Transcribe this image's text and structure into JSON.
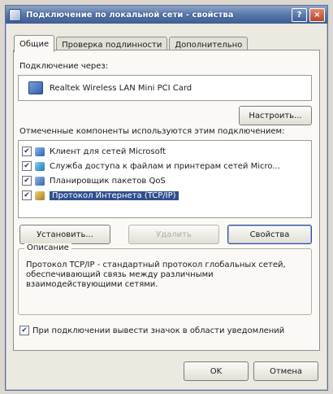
{
  "window": {
    "title": "Подключение по локальной сети - свойства",
    "help_button": "?",
    "close_button": "×"
  },
  "tabs": [
    {
      "label": "Общие",
      "active": true
    },
    {
      "label": "Проверка подлинности",
      "active": false
    },
    {
      "label": "Дополнительно",
      "active": false
    }
  ],
  "connect_via": {
    "label": "Подключение через:",
    "adapter_name": "Realtek Wireless LAN Mini PCI Card",
    "configure_button": "Настроить..."
  },
  "components": {
    "label": "Отмеченные компоненты используются этим подключением:",
    "items": [
      {
        "label": "Клиент для сетей Microsoft",
        "checked": true,
        "icon": "network-client-icon"
      },
      {
        "label": "Служба доступа к файлам и принтерам сетей Micro...",
        "checked": true,
        "icon": "file-sharing-icon"
      },
      {
        "label": "Планировщик пакетов QoS",
        "checked": true,
        "icon": "qos-icon"
      },
      {
        "label": "Протокол Интернета (TCP/IP)",
        "checked": true,
        "selected": true,
        "icon": "protocol-icon"
      }
    ]
  },
  "actions": {
    "install": "Установить...",
    "remove": "Удалить",
    "properties": "Свойства"
  },
  "description": {
    "title": "Описание",
    "text": "Протокол TCP/IP - стандартный протокол глобальных сетей, обеспечивающий связь между различными взаимодействующими сетями."
  },
  "show_icon": {
    "label": "При подключении вывести значок в области уведомлений",
    "checked": true
  },
  "footer": {
    "ok": "OK",
    "cancel": "Отмена"
  },
  "colors": {
    "title_bar": "#3e5d92",
    "selection": "#2f4f8f",
    "dialog_bg": "#ece9e1"
  }
}
